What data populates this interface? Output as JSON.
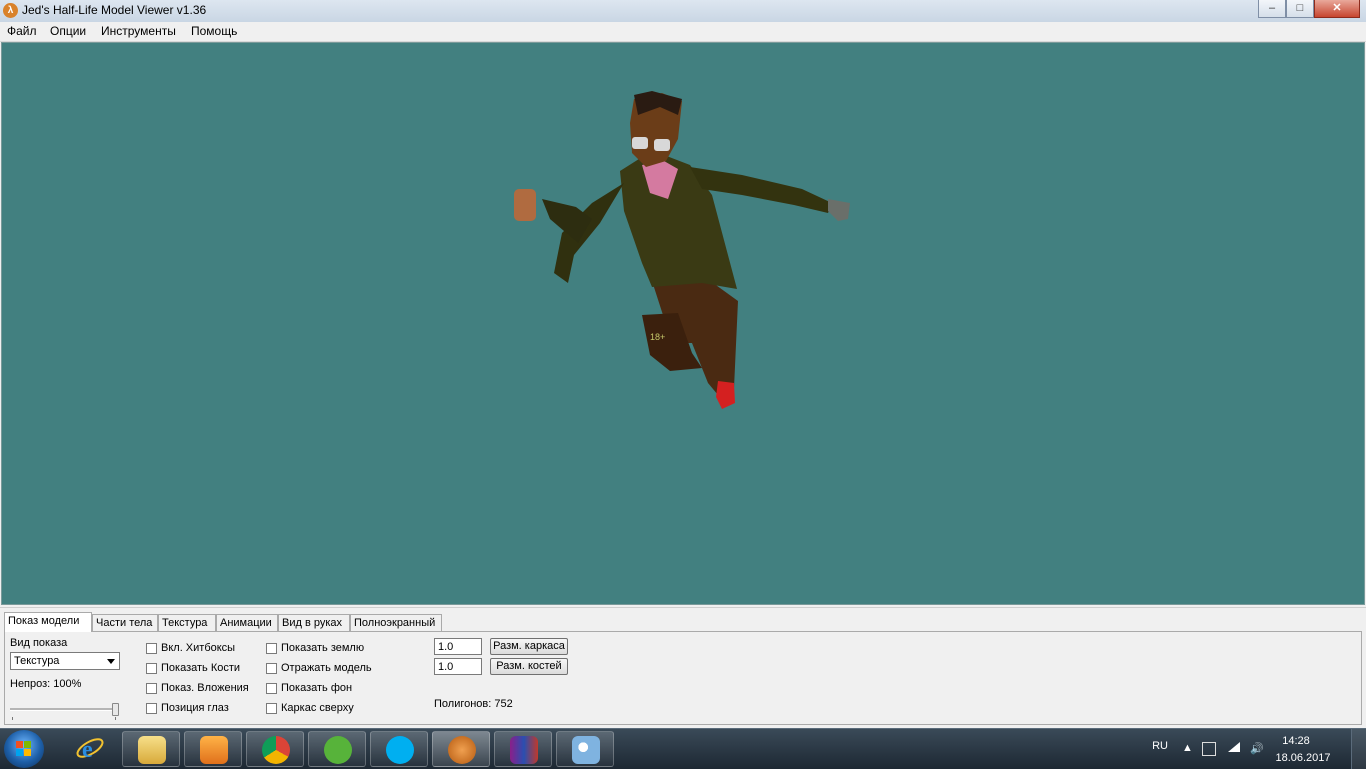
{
  "window": {
    "title": "Jed's Half-Life Model Viewer v1.36",
    "controls": {
      "minimize": "–",
      "maximize": "□",
      "close": "✕"
    }
  },
  "menu": [
    "Файл",
    "Опции",
    "Инструменты",
    "Помощь"
  ],
  "viewport": {
    "background_color": "#428080",
    "model_badge_text": "18+"
  },
  "tabs": [
    "Показ модели",
    "Части тела",
    "Текстура",
    "Анимации",
    "Вид в руках",
    "Полноэкранный"
  ],
  "active_tab": "Показ модели",
  "model_display": {
    "render_mode_label": "Вид показа",
    "render_mode_value": "Текстура",
    "opacity_label": "Непроз: 100%",
    "opacity_value": 1.0,
    "checkboxes_col1": [
      "Вкл. Хитбоксы",
      "Показать Кости",
      "Показ. Вложения",
      "Позиция глаз"
    ],
    "checkboxes_col2": [
      "Показать землю",
      "Отражать модель",
      "Показать фон",
      "Каркас сверху"
    ],
    "wireframe_size_value": "1.0",
    "wireframe_size_button": "Разм. каркаса",
    "bone_size_value": "1.0",
    "bone_size_button": "Разм. костей",
    "polygons_text": "Полигонов: 752"
  },
  "taskbar": {
    "apps": [
      "internet-explorer",
      "file-explorer",
      "media-player",
      "chrome",
      "utorrent",
      "skype",
      "half-life-model-viewer",
      "winrar",
      "paint"
    ],
    "active_app": "half-life-model-viewer",
    "language": "RU",
    "time": "14:28",
    "date": "18.06.2017"
  }
}
